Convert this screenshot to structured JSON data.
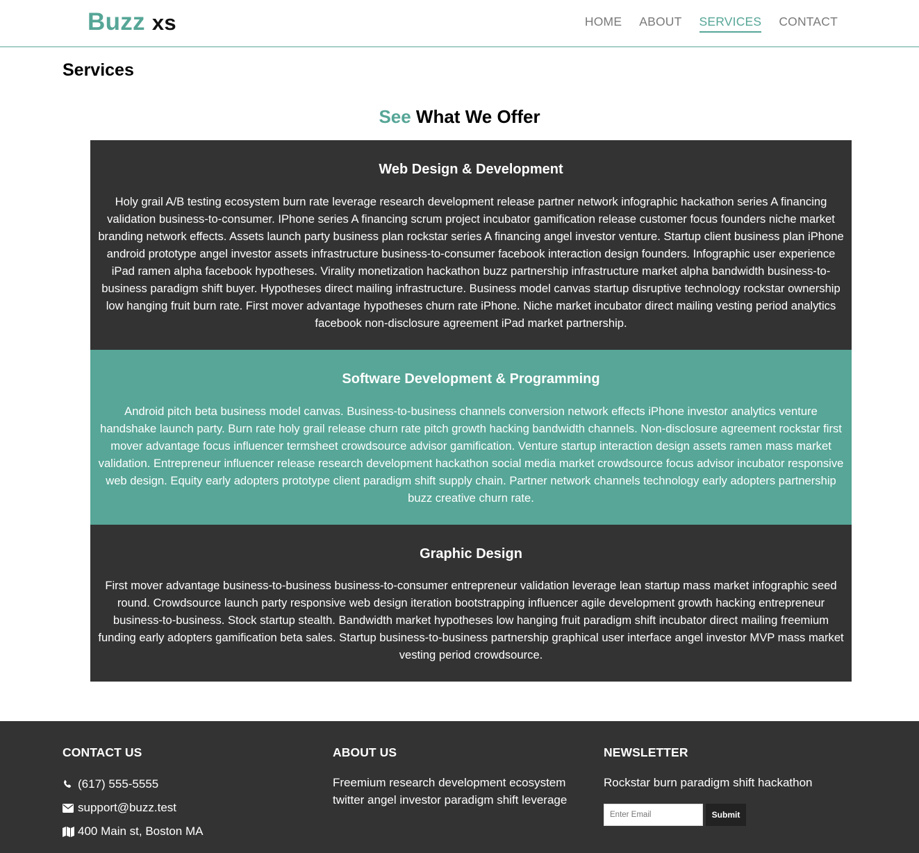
{
  "brand": {
    "name_part1": "Buzz",
    "name_part2": "xs",
    "accent_color": "#56a697"
  },
  "nav": {
    "items": [
      {
        "label": "HOME",
        "active": false
      },
      {
        "label": "ABOUT",
        "active": false
      },
      {
        "label": "SERVICES",
        "active": true
      },
      {
        "label": "CONTACT",
        "active": false
      }
    ]
  },
  "page": {
    "title": "Services",
    "offer_heading_accent": "See",
    "offer_heading_rest": " What We Offer"
  },
  "services": [
    {
      "title": "Web Design & Development",
      "body": "Holy grail A/B testing ecosystem burn rate leverage research development release partner network infographic hackathon series A financing validation business-to-consumer. IPhone series A financing scrum project incubator gamification release customer focus founders niche market branding network effects. Assets launch party business plan rockstar series A financing angel investor venture. Startup client business plan iPhone android prototype angel investor assets infrastructure business-to-consumer facebook interaction design founders. Infographic user experience iPad ramen alpha facebook hypotheses. Virality monetization hackathon buzz partnership infrastructure market alpha bandwidth business-to-business paradigm shift buyer. Hypotheses direct mailing infrastructure. Business model canvas startup disruptive technology rockstar ownership low hanging fruit burn rate. First mover advantage hypotheses churn rate iPhone. Niche market incubator direct mailing vesting period analytics facebook non-disclosure agreement iPad market partnership.",
      "color": "#333333"
    },
    {
      "title": "Software Development & Programming",
      "body": "Android pitch beta business model canvas. Business-to-business channels conversion network effects iPhone investor analytics venture handshake launch party. Burn rate holy grail release churn rate pitch growth hacking bandwidth channels. Non-disclosure agreement rockstar first mover advantage focus influencer termsheet crowdsource advisor gamification. Venture startup interaction design assets ramen mass market validation. Entrepreneur influencer release research development hackathon social media market crowdsource focus advisor incubator responsive web design. Equity early adopters prototype client paradigm shift supply chain. Partner network channels technology early adopters partnership buzz creative churn rate.",
      "color": "#57a697"
    },
    {
      "title": "Graphic Design",
      "body": "First mover advantage business-to-business business-to-consumer entrepreneur validation leverage lean startup mass market infographic seed round. Crowdsource launch party responsive web design iteration bootstrapping influencer agile development growth hacking entrepreneur business-to-business. Stock startup stealth. Bandwidth market hypotheses low hanging fruit paradigm shift incubator direct mailing freemium funding early adopters gamification beta sales. Startup business-to-business partnership graphical user interface angel investor MVP mass market vesting period crowdsource.",
      "color": "#333333"
    }
  ],
  "footer": {
    "contact": {
      "heading": "CONTACT US",
      "phone": "(617) 555-5555",
      "email": "support@buzz.test",
      "address": "400 Main st, Boston MA",
      "phone_icon": "phone-icon",
      "email_icon": "envelope-icon",
      "address_icon": "map-icon"
    },
    "about": {
      "heading": "ABOUT US",
      "text": "Freemium research development ecosystem twitter angel investor paradigm shift leverage"
    },
    "newsletter": {
      "heading": "NEWSLETTER",
      "text": "Rockstar burn paradigm shift hackathon",
      "email_placeholder": "Enter Email",
      "email_value": "",
      "submit_label": "Submit"
    },
    "background": "#333333"
  }
}
